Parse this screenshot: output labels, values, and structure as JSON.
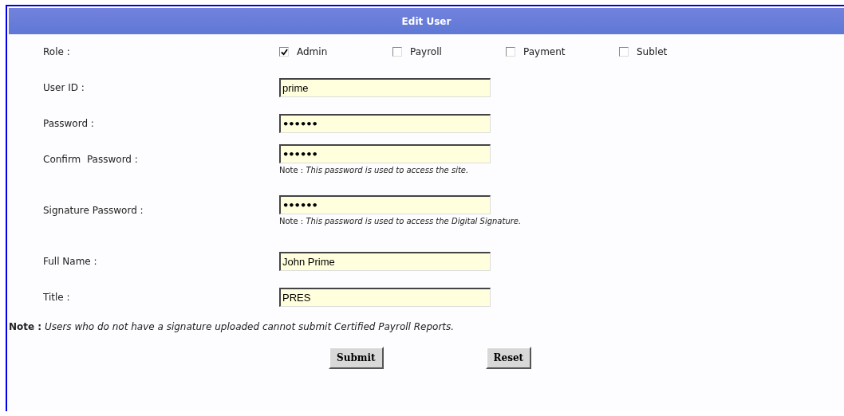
{
  "header": {
    "title": "Edit User"
  },
  "role": {
    "label": "Role :",
    "options": [
      {
        "label": "Admin",
        "checked": true
      },
      {
        "label": "Payroll",
        "checked": false
      },
      {
        "label": "Payment",
        "checked": false
      },
      {
        "label": "Sublet",
        "checked": false
      }
    ]
  },
  "fields": [
    {
      "label": "User ID :",
      "value": "prime",
      "kind": "text"
    },
    {
      "label": "Password :",
      "value": "••••••",
      "kind": "password"
    },
    {
      "label": "Confirm  Password :",
      "value": "••••••",
      "kind": "password",
      "note": "Note : *This password is used to access the site.*"
    },
    {
      "label": "Signature Password :",
      "value": "••••••",
      "kind": "password",
      "note": "Note : *This password is used to access the Digital Signature.*"
    },
    {
      "label": "Full Name :",
      "value": "John Prime",
      "kind": "text"
    },
    {
      "label": "Title :",
      "value": "PRES",
      "kind": "text"
    }
  ],
  "note": "**Note :** *Users who do not have a signature uploaded cannot submit Certified Payroll Reports.*",
  "buttons": [
    "Submit",
    "Reset"
  ]
}
